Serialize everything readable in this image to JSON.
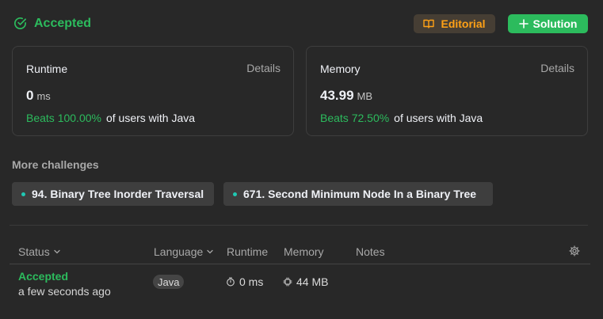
{
  "header": {
    "status": "Accepted",
    "editorial_label": "Editorial",
    "solution_label": "Solution"
  },
  "runtime_card": {
    "title": "Runtime",
    "details": "Details",
    "value": "0",
    "unit": "ms",
    "beats": "Beats 100.00%",
    "suffix": "of users with Java"
  },
  "memory_card": {
    "title": "Memory",
    "details": "Details",
    "value": "43.99",
    "unit": "MB",
    "beats": "Beats 72.50%",
    "suffix": "of users with Java"
  },
  "challenges": {
    "title": "More challenges",
    "items": [
      {
        "label": "94. Binary Tree Inorder Traversal"
      },
      {
        "label": "671. Second Minimum Node In a Binary Tree"
      }
    ]
  },
  "table": {
    "headers": {
      "status": "Status",
      "language": "Language",
      "runtime": "Runtime",
      "memory": "Memory",
      "notes": "Notes"
    },
    "rows": [
      {
        "status": "Accepted",
        "time": "a few seconds ago",
        "language": "Java",
        "runtime": "0 ms",
        "memory": "44 MB"
      }
    ]
  },
  "colors": {
    "accent_green": "#2cbb5d",
    "editorial_orange": "#ffa116",
    "dot_teal": "#20c9b3"
  }
}
